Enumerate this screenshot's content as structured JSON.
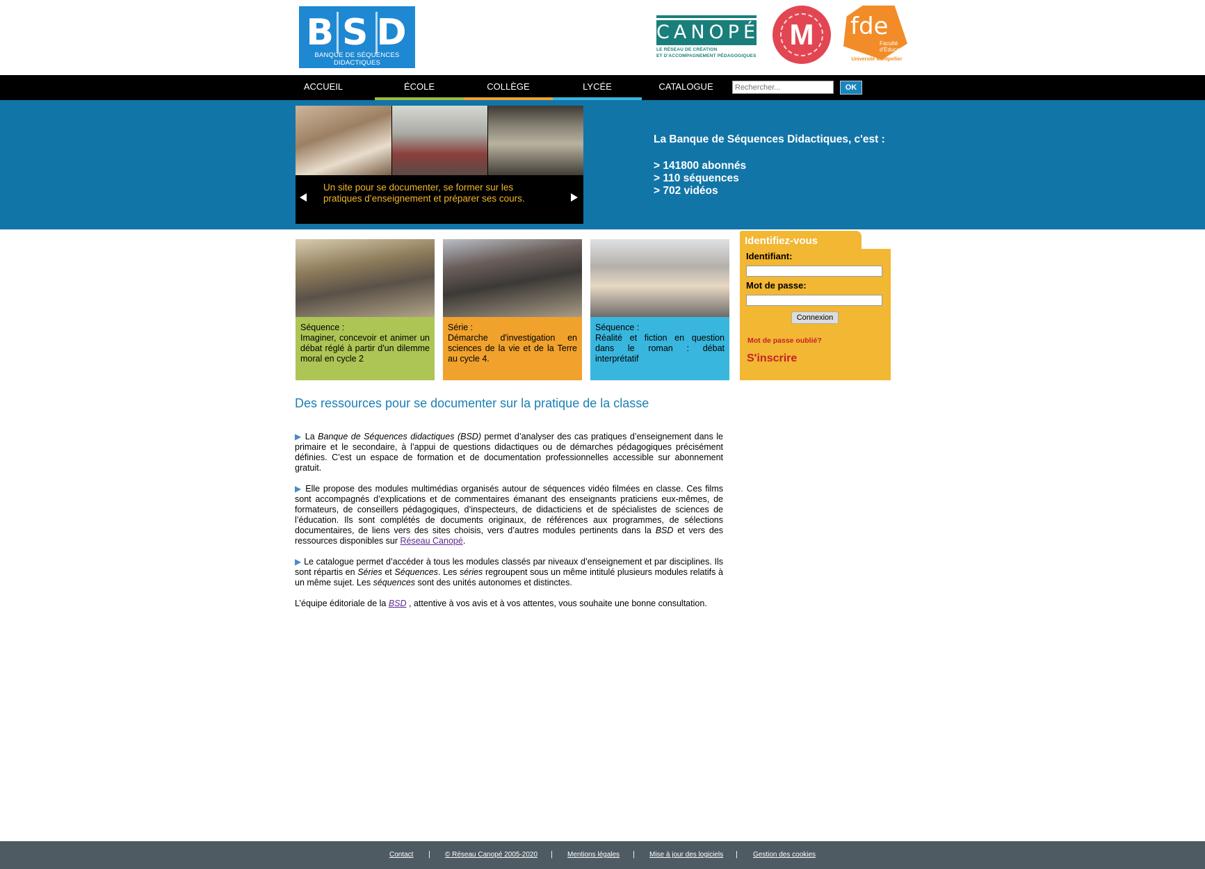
{
  "header": {
    "bsd_logo_letters": "BSD",
    "bsd_logo_subtitle": "BANQUE DE SÉQUENCES DIDACTIQUES",
    "canope_logo_top": "RÉSEAU CANOPÉ",
    "canope_logo_word": "CANOPÉ",
    "canope_logo_sub1": "LE RÉSEAU DE CRÉATION",
    "canope_logo_sub2": "ET D'ACCOMPAGNEMENT PÉDAGOGIQUES",
    "univ_logo_letter": "M",
    "fde_logo_word": "fde",
    "fde_logo_sub": "Faculté d'Éducation",
    "fde_logo_univ": "Université Montpellier"
  },
  "nav": {
    "items": [
      {
        "label": "ACCUEIL",
        "underline": ""
      },
      {
        "label": "ÉCOLE",
        "underline": "#9dbb3e"
      },
      {
        "label": "COLLÈGE",
        "underline": "#f0a22d"
      },
      {
        "label": "LYCÉE",
        "underline": "#39b6dd"
      },
      {
        "label": "CATALOGUE",
        "underline": ""
      }
    ],
    "search_placeholder": "Rechercher...",
    "search_button": "OK"
  },
  "hero": {
    "caption": "Un site pour se documenter, se former sur les pratiques d’enseignement et préparer ses cours.",
    "info_title": "La Banque de Séquences Didactiques, c'est :",
    "stats": [
      "> 141800 abonnés",
      "> 110 séquences",
      "> 702 vidéos"
    ]
  },
  "cards": [
    {
      "type": "Séquence :",
      "title": "Imaginer, concevoir et animer un débat réglé à partir d'un dilemme moral en cycle 2",
      "color": "#adc555"
    },
    {
      "type": "Série :",
      "title": "Démarche d'investigation en sciences de la vie et de la Terre au cycle 4.",
      "color": "#f0a22d"
    },
    {
      "type": "Séquence :",
      "title": "Réalité et fiction en question dans le roman : débat interprétatif",
      "color": "#39b6dd"
    }
  ],
  "login": {
    "title": "Identifiez-vous",
    "id_label": "Identifiant:",
    "pwd_label": "Mot de passe:",
    "button": "Connexion",
    "forgot": "Mot de passe oublié?",
    "signup": "S'inscrire"
  },
  "article": {
    "heading": "Des ressources pour se documenter sur la pratique de la classe",
    "p1_a": "La ",
    "p1_em": "Banque de Séquences didactiques (BSD)",
    "p1_b": " permet d’analyser des cas pratiques d’enseignement dans le primaire et le secondaire, à l’appui de questions didactiques ou de démarches pédagogiques précisément définies. C’est un espace de formation et de documentation professionnelles accessible sur abonnement gratuit.",
    "p2_a": "Elle propose des modules multimédias organisés autour de séquences vidéo filmées en classe. Ces films sont accompagnés d’explications et de commentaires émanant des enseignants praticiens eux-mêmes, de formateurs, de conseillers pédagogiques, d’inspecteurs, de didacticiens et de spécialistes de sciences de l’éducation. Ils sont complétés de documents originaux, de références aux programmes, de sélections documentaires, de liens vers des sites choisis, vers d’autres modules pertinents dans la ",
    "p2_em": "BSD",
    "p2_b": " et vers des ressources disponibles sur ",
    "p2_link": "Réseau Canopé",
    "p2_c": ".",
    "p3_a": "Le catalogue permet d’accéder à tous les modules classés par niveaux d’enseignement et par disciplines. Ils sont répartis en ",
    "p3_em1": "Séries",
    "p3_b": " et ",
    "p3_em2": "Séquences",
    "p3_c": ". Les ",
    "p3_em3": "séries",
    "p3_d": " regroupent sous un même intitulé plusieurs modules relatifs à un même sujet. Les ",
    "p3_em4": "séquences",
    "p3_e": " sont des unités autonomes et distinctes.",
    "p4_a": "L’équipe éditoriale de la ",
    "p4_link": "BSD",
    "p4_b": " , attentive à vos avis et à vos attentes, vous souhaite une bonne consultation."
  },
  "footer": {
    "links": [
      "Contact",
      "© Réseau Canopé 2005-2020",
      "Mentions légales",
      "Mise à jour des logiciels",
      "Gestion des cookies"
    ],
    "separator": "|"
  }
}
